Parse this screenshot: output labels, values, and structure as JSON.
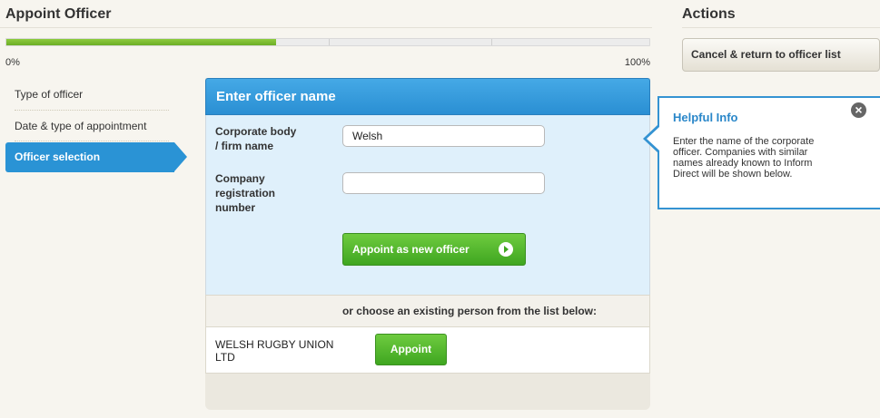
{
  "header": {
    "title": "Appoint Officer",
    "actions_title": "Actions"
  },
  "progress": {
    "fraction": 0.42,
    "start_label": "0%",
    "end_label": "100%"
  },
  "steps": [
    {
      "label": "Type of officer",
      "state": "done"
    },
    {
      "label": "Date & type of appointment",
      "state": "done"
    },
    {
      "label": "Officer selection",
      "state": "active"
    }
  ],
  "panel": {
    "title": "Enter officer name",
    "fields": {
      "corporate_label_line1": "Corporate body",
      "corporate_label_line2": "/ firm name",
      "corporate_value": "Welsh",
      "regnum_label_line1": "Company",
      "regnum_label_line2": "registration",
      "regnum_label_line3": "number",
      "regnum_value": ""
    },
    "appoint_new_label": "Appoint as new officer",
    "choose_text": "or choose an existing person from the list below:",
    "results": [
      {
        "name_line1": "WELSH RUGBY UNION",
        "name_line2": "LTD",
        "action": "Appoint"
      }
    ]
  },
  "actions": {
    "cancel_label": "Cancel & return to officer list"
  },
  "helpful_info": {
    "title": "Helpful Info",
    "line1": "Enter the name of the corporate",
    "line2": "officer. Companies with similar",
    "line3": "names already known to Inform",
    "line4": "Direct will be shown below.",
    "close_icon": "close-icon"
  },
  "colors": {
    "accent_blue": "#2a93d5",
    "progress_green": "#7cbd34",
    "button_green": "#4cb82a"
  }
}
